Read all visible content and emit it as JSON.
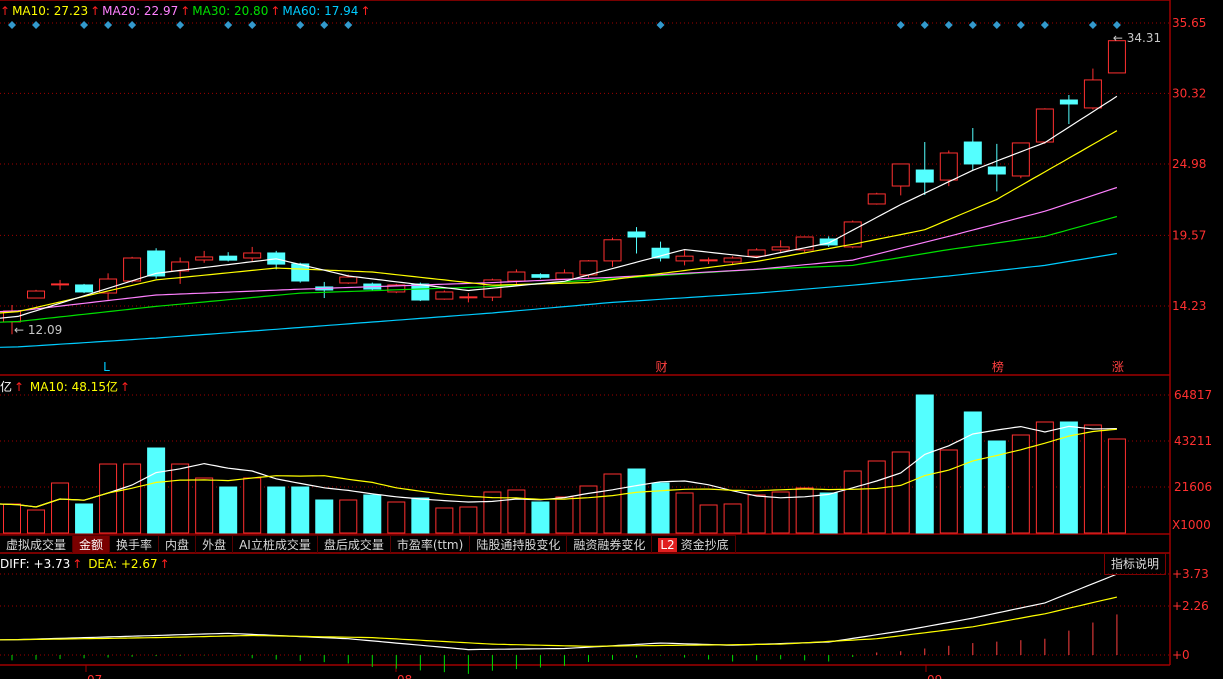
{
  "price_legend": [
    {
      "label": "MA10: 27.23",
      "color": "#ffff00"
    },
    {
      "label": "MA20: 22.97",
      "color": "#ff80ff"
    },
    {
      "label": "MA30: 20.80",
      "color": "#00e000"
    },
    {
      "label": "MA60: 17.94",
      "color": "#00ccff"
    }
  ],
  "volume_legend": {
    "unit": "亿",
    "ma_label": "MA10: 48.15亿"
  },
  "macd_legend": {
    "diff": "DIFF: +3.73",
    "dea": "DEA: +2.67"
  },
  "arrow_glyph": "↑",
  "tabs": [
    {
      "label": "虚拟成交量"
    },
    {
      "label": "金额",
      "active": true
    },
    {
      "label": "换手率"
    },
    {
      "label": "内盘"
    },
    {
      "label": "外盘"
    },
    {
      "label": "AI立桩成交量"
    },
    {
      "label": "盘后成交量"
    },
    {
      "label": "市盈率(ttm)"
    },
    {
      "label": "陆股通持股变化"
    },
    {
      "label": "融资融券变化"
    },
    {
      "label": "资金抄底",
      "badge": "L2"
    }
  ],
  "help_button": "指标说明",
  "price_axis": [
    "35.65",
    "30.32",
    "24.98",
    "19.57",
    "14.23"
  ],
  "volume_axis": [
    "64817",
    "43211",
    "21606",
    "X1000"
  ],
  "macd_axis": [
    "+3.73",
    "+2.26",
    "+0"
  ],
  "time_axis": [
    "07",
    "08",
    "09"
  ],
  "annotations": {
    "low_label": "12.09",
    "high_label": "34.31"
  },
  "event_markers": [
    {
      "index": 4,
      "text": "L",
      "color": "#00ccff"
    },
    {
      "index": 27,
      "text": "财",
      "color": "#ff4040"
    },
    {
      "index": 41,
      "text": "榜",
      "color": "#ff4040"
    },
    {
      "index": 46,
      "text": "涨",
      "color": "#ff4040"
    }
  ],
  "diamond_indices": [
    0,
    1,
    3,
    4,
    5,
    7,
    9,
    10,
    12,
    13,
    14,
    27,
    37,
    38,
    39,
    40,
    41,
    42,
    43,
    45,
    46
  ],
  "colors": {
    "up": "#ff3030",
    "down": "#54ffff",
    "grid": "#a00000",
    "ma5": "#ffffff",
    "ma10": "#ffff00",
    "ma20": "#ff80ff",
    "ma30": "#00e000",
    "ma60": "#00ccff",
    "diamond": "#3399cc"
  },
  "chart_data": {
    "type": "candlestick",
    "price_range": [
      9.5,
      36.5
    ],
    "ohlc": [
      [
        13.02,
        14.3,
        12.09,
        13.85
      ],
      [
        14.83,
        15.45,
        14.8,
        15.36
      ],
      [
        15.85,
        16.2,
        15.45,
        15.9
      ],
      [
        15.82,
        15.9,
        15.2,
        15.29
      ],
      [
        15.21,
        16.7,
        14.7,
        16.27
      ],
      [
        16.12,
        17.95,
        16.0,
        17.86
      ],
      [
        18.39,
        18.6,
        16.3,
        16.5
      ],
      [
        16.88,
        17.9,
        15.9,
        17.56
      ],
      [
        17.71,
        18.4,
        17.5,
        17.94
      ],
      [
        18.0,
        18.3,
        17.6,
        17.7
      ],
      [
        17.86,
        18.7,
        17.6,
        18.24
      ],
      [
        18.24,
        18.4,
        17.0,
        17.4
      ],
      [
        17.41,
        17.5,
        16.0,
        16.12
      ],
      [
        15.67,
        16.05,
        14.83,
        15.44
      ],
      [
        15.97,
        16.6,
        15.9,
        16.42
      ],
      [
        15.89,
        16.0,
        15.4,
        15.51
      ],
      [
        15.29,
        15.9,
        15.2,
        15.82
      ],
      [
        15.89,
        16.0,
        14.6,
        14.68
      ],
      [
        14.75,
        15.4,
        14.7,
        15.29
      ],
      [
        14.88,
        15.2,
        14.5,
        14.92
      ],
      [
        14.9,
        16.3,
        14.6,
        16.2
      ],
      [
        16.12,
        17.0,
        15.9,
        16.8
      ],
      [
        16.6,
        16.7,
        16.3,
        16.4
      ],
      [
        16.27,
        17.0,
        16.2,
        16.73
      ],
      [
        16.58,
        17.7,
        16.4,
        17.64
      ],
      [
        17.64,
        19.4,
        17.2,
        19.24
      ],
      [
        19.83,
        20.2,
        18.2,
        19.45
      ],
      [
        18.6,
        19.1,
        17.6,
        17.86
      ],
      [
        17.64,
        18.5,
        17.3,
        18.0
      ],
      [
        17.68,
        17.9,
        17.4,
        17.72
      ],
      [
        17.56,
        18.0,
        17.4,
        17.86
      ],
      [
        18.0,
        18.6,
        17.9,
        18.47
      ],
      [
        18.47,
        19.2,
        18.3,
        18.7
      ],
      [
        18.47,
        19.5,
        18.3,
        19.45
      ],
      [
        19.3,
        19.5,
        18.7,
        18.85
      ],
      [
        18.7,
        20.7,
        18.6,
        20.59
      ],
      [
        21.95,
        22.8,
        21.9,
        22.71
      ],
      [
        23.31,
        25.0,
        22.6,
        24.98
      ],
      [
        24.52,
        26.64,
        22.63,
        23.61
      ],
      [
        23.76,
        26.0,
        23.3,
        25.81
      ],
      [
        26.64,
        27.7,
        24.5,
        24.98
      ],
      [
        24.75,
        26.5,
        22.9,
        24.22
      ],
      [
        24.07,
        26.6,
        23.9,
        26.57
      ],
      [
        26.64,
        29.2,
        26.5,
        29.14
      ],
      [
        29.82,
        30.2,
        28.0,
        29.52
      ],
      [
        29.22,
        32.2,
        29.1,
        31.34
      ],
      [
        31.87,
        34.31,
        31.87,
        34.31
      ]
    ],
    "ma_lines": {
      "ma5": [
        [
          0,
          13.3
        ],
        [
          6,
          16.7
        ],
        [
          11,
          17.8
        ],
        [
          14,
          16.5
        ],
        [
          19,
          15.4
        ],
        [
          23,
          16.1
        ],
        [
          28,
          18.5
        ],
        [
          31,
          17.9
        ],
        [
          34,
          19.0
        ],
        [
          37,
          21.9
        ],
        [
          40,
          24.5
        ],
        [
          43,
          26.6
        ],
        [
          46,
          30.1
        ]
      ],
      "ma10": [
        [
          0,
          13.7
        ],
        [
          6,
          16.2
        ],
        [
          11,
          17.1
        ],
        [
          15,
          16.8
        ],
        [
          20,
          15.8
        ],
        [
          24,
          16.0
        ],
        [
          31,
          17.6
        ],
        [
          35,
          18.9
        ],
        [
          38,
          20.0
        ],
        [
          41,
          22.3
        ],
        [
          46,
          27.5
        ]
      ],
      "ma20": [
        [
          0,
          13.8
        ],
        [
          6,
          15.06
        ],
        [
          12,
          15.5
        ],
        [
          20,
          16.0
        ],
        [
          25,
          16.4
        ],
        [
          31,
          17.0
        ],
        [
          35,
          17.7
        ],
        [
          39,
          19.5
        ],
        [
          43,
          21.4
        ],
        [
          46,
          23.2
        ]
      ],
      "ma30": [
        [
          0,
          13.0
        ],
        [
          6,
          14.2
        ],
        [
          12,
          15.2
        ],
        [
          20,
          15.7
        ],
        [
          25,
          16.3
        ],
        [
          31,
          17.0
        ],
        [
          35,
          17.3
        ],
        [
          39,
          18.5
        ],
        [
          43,
          19.5
        ],
        [
          46,
          21.0
        ]
      ],
      "ma60": [
        [
          0,
          11.1
        ],
        [
          6,
          11.8
        ],
        [
          12,
          12.6
        ],
        [
          20,
          13.7
        ],
        [
          25,
          14.5
        ],
        [
          31,
          15.2
        ],
        [
          35,
          15.8
        ],
        [
          39,
          16.5
        ],
        [
          43,
          17.3
        ],
        [
          46,
          18.2
        ]
      ]
    },
    "volume_x1000": [
      13630,
      10800,
      23490,
      13630,
      32400,
      32400,
      39920,
      32400,
      25830,
      21600,
      25830,
      21600,
      21600,
      15500,
      15500,
      17850,
      14560,
      16440,
      11740,
      12210,
      19260,
      20200,
      14560,
      16910,
      22080,
      27710,
      30060,
      23490,
      18790,
      13150,
      13630,
      17850,
      19260,
      21140,
      18790,
      29120,
      33820,
      38050,
      64817,
      38990,
      56840,
      43210,
      46030,
      52140,
      52140,
      50730,
      44150
    ],
    "volume_range": [
      0,
      64817
    ],
    "macd": {
      "diff": [
        [
          0,
          0.7
        ],
        [
          6,
          0.9
        ],
        [
          9,
          1.0
        ],
        [
          14,
          0.75
        ],
        [
          19,
          0.25
        ],
        [
          23,
          0.3
        ],
        [
          27,
          0.55
        ],
        [
          30,
          0.45
        ],
        [
          34,
          0.6
        ],
        [
          37,
          1.1
        ],
        [
          40,
          1.7
        ],
        [
          43,
          2.4
        ],
        [
          46,
          3.73
        ]
      ],
      "dea": [
        [
          0,
          0.7
        ],
        [
          6,
          0.8
        ],
        [
          10,
          0.9
        ],
        [
          15,
          0.8
        ],
        [
          20,
          0.5
        ],
        [
          24,
          0.4
        ],
        [
          28,
          0.45
        ],
        [
          32,
          0.5
        ],
        [
          36,
          0.75
        ],
        [
          40,
          1.3
        ],
        [
          43,
          1.9
        ],
        [
          46,
          2.67
        ]
      ],
      "range": [
        -0.5,
        3.73
      ]
    }
  }
}
